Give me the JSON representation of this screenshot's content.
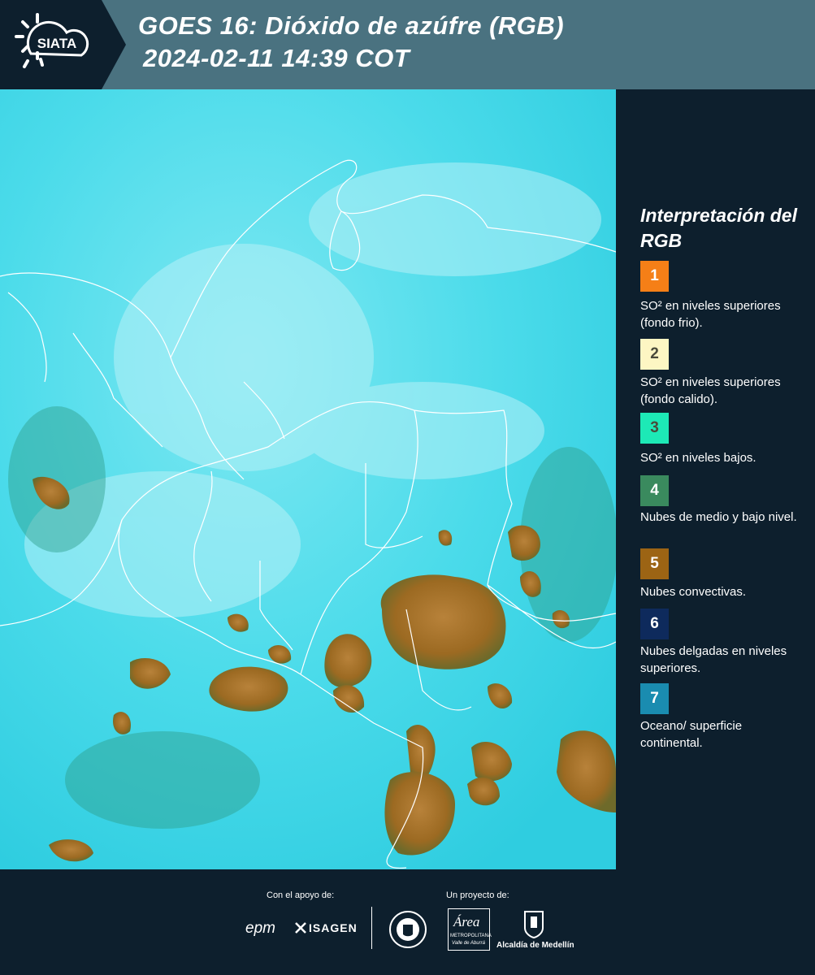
{
  "header": {
    "logo_text": "SIATA",
    "title_line1": "GOES 16: Dióxido de azúfre (RGB)",
    "title_line2": "2024-02-11 14:39 COT"
  },
  "colors": {
    "header_bg": "#4a7280",
    "panel_bg": "#0d1f2d",
    "map_background": "#33d8ea",
    "borders": "#ffffff"
  },
  "legend": {
    "title": "Interpretación del RGB",
    "items": [
      {
        "num": "1",
        "color": "#f57f17",
        "text": "SO² en niveles superiores (fondo frio)."
      },
      {
        "num": "2",
        "color": "#fdf6c3",
        "text": "SO² en niveles superiores (fondo calido)."
      },
      {
        "num": "3",
        "color": "#1de9b6",
        "text": "SO² en niveles bajos."
      },
      {
        "num": "4",
        "color": "#3a8a5e",
        "text": "Nubes de medio y bajo nivel."
      },
      {
        "num": "5",
        "color": "#9c6414",
        "text": "Nubes convectivas."
      },
      {
        "num": "6",
        "color": "#0e2a5c",
        "text": "Nubes delgadas en niveles superiores."
      },
      {
        "num": "7",
        "color": "#1a8cb0",
        "text": "Oceano/ superficie continental."
      }
    ]
  },
  "footer": {
    "support_label": "Con el apoyo de:",
    "project_label": "Un proyecto de:",
    "sponsor_epm": "epm",
    "sponsor_isagen": "ISAGEN",
    "partner_area_name": "Área",
    "partner_area_sub1": "METROPOLITANA",
    "partner_area_sub2": "Valle de Aburrá",
    "partner_alcaldia": "Alcaldía de Medellín"
  }
}
